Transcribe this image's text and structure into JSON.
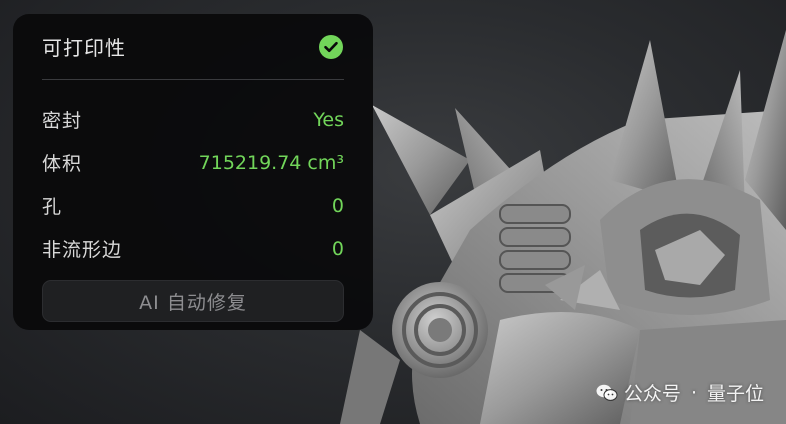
{
  "panel": {
    "title": "可打印性",
    "status_icon": "check-circle-icon",
    "accent_color": "#72d65a",
    "rows": [
      {
        "label": "密封",
        "value": "Yes"
      },
      {
        "label": "体积",
        "value": "715219.74 cm³"
      },
      {
        "label": "孔",
        "value": "0"
      },
      {
        "label": "非流形边",
        "value": "0"
      }
    ],
    "fix_button_label": "AI 自动修复"
  },
  "watermark": {
    "icon": "wechat-icon",
    "account": "公众号",
    "separator": "·",
    "name": "量子位"
  }
}
